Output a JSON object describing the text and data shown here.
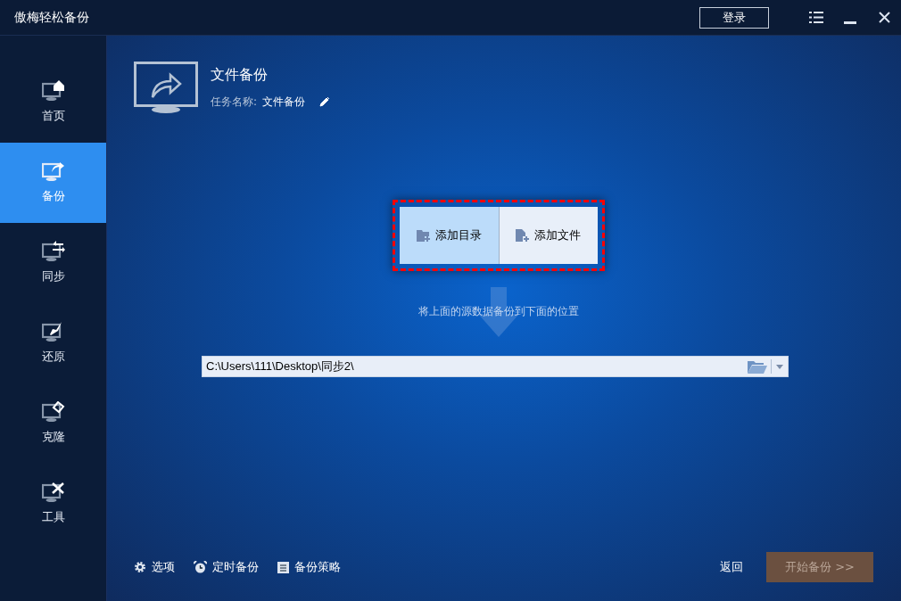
{
  "window": {
    "title": "傲梅轻松备份",
    "login_button": "登录"
  },
  "sidebar": {
    "items": [
      {
        "kind": "home",
        "label": "首页",
        "selected": false
      },
      {
        "kind": "backup",
        "label": "备份",
        "selected": true
      },
      {
        "kind": "sync",
        "label": "同步",
        "selected": false
      },
      {
        "kind": "restore",
        "label": "还原",
        "selected": false
      },
      {
        "kind": "clone",
        "label": "克隆",
        "selected": false
      },
      {
        "kind": "tools",
        "label": "工具",
        "selected": false
      }
    ]
  },
  "task": {
    "title": "文件备份",
    "name_label": "任务名称:",
    "name_value": "文件备份"
  },
  "source_buttons": [
    {
      "kind": "folder",
      "label": "添加目录",
      "selected": true
    },
    {
      "kind": "file",
      "label": "添加文件",
      "selected": false
    }
  ],
  "hint": "将上面的源数据备份到下面的位置",
  "destination": {
    "value": "C:\\Users\\111\\Desktop\\同步2\\"
  },
  "footer": {
    "links": [
      {
        "kind": "gear",
        "label": "选项"
      },
      {
        "kind": "clock",
        "label": "定时备份"
      },
      {
        "kind": "clipboard",
        "label": "备份策略"
      }
    ],
    "back": "返回",
    "start": {
      "label": "开始备份 >>",
      "disabled": true
    }
  }
}
